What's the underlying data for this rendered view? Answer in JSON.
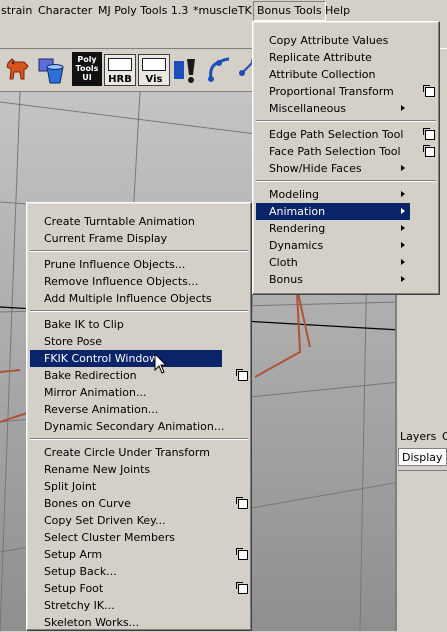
{
  "menubar": {
    "items": [
      "strain",
      "Character",
      "MJ Poly Tools 1.3",
      "*muscleTK",
      "Bonus Tools",
      "Help"
    ],
    "open_item": "Bonus Tools"
  },
  "shelf": {
    "poly_tools_label": [
      "Poly",
      "Tools",
      "UI"
    ],
    "hrb_label": "HRB",
    "vis_label": "Vis"
  },
  "right_panel": {
    "tabs": [
      "Layers",
      "O"
    ],
    "display_value": "Display"
  },
  "bonus_menu": {
    "groups": [
      [
        {
          "label": "Copy Attribute Values"
        },
        {
          "label": "Replicate Attribute"
        },
        {
          "label": "Attribute Collection"
        },
        {
          "label": "Proportional Transform",
          "option_box": true
        },
        {
          "label": "Miscellaneous",
          "submenu": true
        }
      ],
      [
        {
          "label": "Edge Path Selection Tool",
          "option_box": true
        },
        {
          "label": "Face Path Selection Tool",
          "option_box": true
        },
        {
          "label": "Show/Hide Faces",
          "submenu": true
        }
      ],
      [
        {
          "label": "Modeling",
          "submenu": true
        },
        {
          "label": "Animation",
          "submenu": true,
          "highlighted": true
        },
        {
          "label": "Rendering",
          "submenu": true
        },
        {
          "label": "Dynamics",
          "submenu": true
        },
        {
          "label": "Cloth",
          "submenu": true
        },
        {
          "label": "Bonus",
          "submenu": true
        }
      ]
    ]
  },
  "animation_submenu": {
    "groups": [
      [
        {
          "label": "Create Turntable Animation"
        },
        {
          "label": "Current Frame Display"
        }
      ],
      [
        {
          "label": "Prune Influence Objects..."
        },
        {
          "label": "Remove Influence Objects..."
        },
        {
          "label": "Add Multiple Influence Objects"
        }
      ],
      [
        {
          "label": "Bake IK to Clip"
        },
        {
          "label": "Store Pose"
        },
        {
          "label": "FKIK Control Window",
          "highlighted": true
        },
        {
          "label": "Bake Redirection",
          "option_box": true
        },
        {
          "label": "Mirror Animation..."
        },
        {
          "label": "Reverse Animation..."
        },
        {
          "label": "Dynamic Secondary Animation..."
        }
      ],
      [
        {
          "label": "Create Circle Under Transform"
        },
        {
          "label": "Rename New Joints"
        },
        {
          "label": "Split Joint"
        },
        {
          "label": "Bones on Curve",
          "option_box": true
        },
        {
          "label": "Copy Set Driven Key..."
        },
        {
          "label": "Select Cluster Members"
        },
        {
          "label": "Setup Arm",
          "option_box": true
        },
        {
          "label": "Setup Back..."
        },
        {
          "label": "Setup Foot",
          "option_box": true
        },
        {
          "label": "Stretchy IK..."
        },
        {
          "label": "Skeleton Works..."
        }
      ]
    ]
  },
  "colors": {
    "menu_bg": "#d4d0c8",
    "highlight": "#0a246a",
    "highlight_text": "#ffffff",
    "bone": "#b0523a"
  },
  "icons": [
    "dog-icon",
    "bucket-icon",
    "cube-dot-icon",
    "character-icon",
    "ik-curve-icon",
    "connect-icon",
    "mouse-pointer-icon"
  ]
}
